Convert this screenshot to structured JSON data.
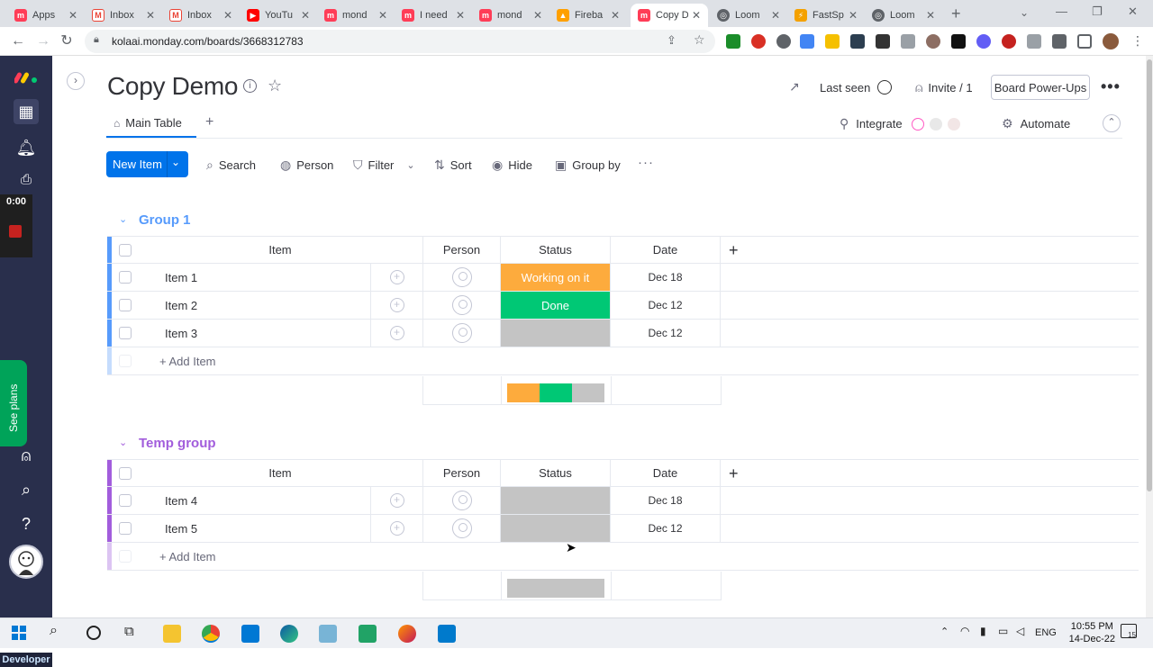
{
  "browser": {
    "tabs": [
      {
        "title": "Apps",
        "icon": "monday-icon",
        "color": "#ff3d57"
      },
      {
        "title": "Inbox",
        "icon": "gmail-icon",
        "color": "#ea4335"
      },
      {
        "title": "Inbox",
        "icon": "gmail-icon",
        "color": "#ea4335"
      },
      {
        "title": "YouTu",
        "icon": "youtube-icon",
        "color": "#ff0000"
      },
      {
        "title": "mond",
        "icon": "monday-icon",
        "color": "#ff3d57"
      },
      {
        "title": "I need",
        "icon": "monday-icon",
        "color": "#ff3d57"
      },
      {
        "title": "mond",
        "icon": "monday-icon",
        "color": "#ff3d57"
      },
      {
        "title": "Fireba",
        "icon": "firebase-icon",
        "color": "#ffa000"
      },
      {
        "title": "Copy D",
        "icon": "monday-icon",
        "color": "#ff3d57",
        "active": true
      },
      {
        "title": "Loom",
        "icon": "globe-icon",
        "color": "#5f6368"
      },
      {
        "title": "FastSp",
        "icon": "fastspring-icon",
        "color": "#f4a100"
      },
      {
        "title": "Loom",
        "icon": "globe-icon",
        "color": "#5f6368"
      }
    ],
    "url": "kolaai.monday.com/boards/3668312783"
  },
  "rail": {
    "timer": "0:00",
    "see_plans": "See plans",
    "developer": "Developer"
  },
  "board": {
    "title": "Copy Demo",
    "last_seen": "Last seen",
    "invite": "Invite / 1",
    "power_ups": "Board Power-Ups",
    "main_table_tab": "Main Table",
    "add_view": "+",
    "integrate": "Integrate",
    "automate": "Automate"
  },
  "toolbar": {
    "new_item": "New Item",
    "search": "Search",
    "person": "Person",
    "filter": "Filter",
    "sort": "Sort",
    "hide": "Hide",
    "group_by": "Group by"
  },
  "colors": {
    "working": "#fdab3d",
    "done": "#00c875",
    "empty": "#c4c4c4",
    "group1": "#579bfc",
    "temp_group": "#a25ddc",
    "brand_blue": "#0073ea"
  },
  "groups": [
    {
      "name": "Group 1",
      "columns": {
        "item": "Item",
        "person": "Person",
        "status": "Status",
        "date": "Date",
        "add": "+"
      },
      "rows": [
        {
          "item": "Item 1",
          "status": "Working on it",
          "date": "Dec 18"
        },
        {
          "item": "Item 2",
          "status": "Done",
          "date": "Dec 12"
        },
        {
          "item": "Item 3",
          "status": "",
          "date": "Dec 12"
        }
      ],
      "add_item": "+ Add Item"
    },
    {
      "name": "Temp group",
      "columns": {
        "item": "Item",
        "person": "Person",
        "status": "Status",
        "date": "Date",
        "add": "+"
      },
      "rows": [
        {
          "item": "Item 4",
          "status": "",
          "date": "Dec 18"
        },
        {
          "item": "Item 5",
          "status": "",
          "date": "Dec 12"
        }
      ],
      "add_item": "+ Add Item"
    }
  ],
  "taskbar": {
    "lang": "ENG",
    "time": "10:55 PM",
    "date": "14-Dec-22",
    "notifications": "15"
  }
}
